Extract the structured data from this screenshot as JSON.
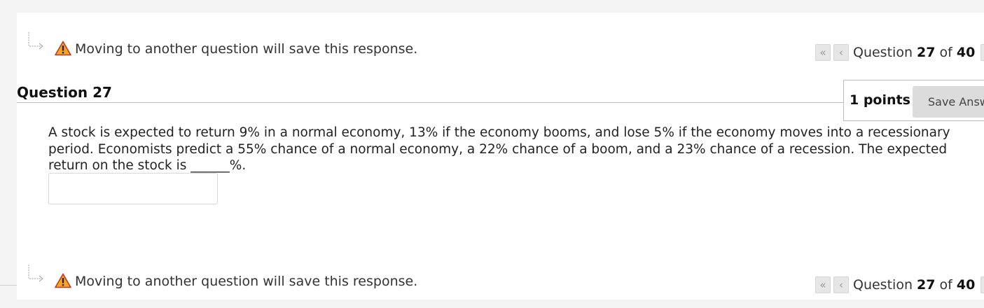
{
  "warning": {
    "text": "Moving to another question will save this response."
  },
  "nav": {
    "prefix": "Question",
    "current": "27",
    "of_word": "of",
    "total": "40",
    "first_glyph": "«",
    "prev_glyph": "‹",
    "next_glyph": "›"
  },
  "question": {
    "title": "Question 27",
    "points_label": "1 points",
    "save_label": "Save Answer",
    "body": "A stock is expected to return 9% in a normal economy, 13% if the economy booms, and lose 5% if the economy moves into a recessionary period. Economists predict a 55% chance of a normal economy, a 22% chance of a boom, and a 23% chance of a recession. The expected return on the stock is ______%.",
    "answer_value": ""
  },
  "icons": {
    "arrow": "corner-arrow-icon",
    "warning": "warning-triangle-icon"
  },
  "colors": {
    "warning_fill": "#f5a623",
    "warning_stroke": "#c0392b",
    "button_bg": "#dcdcdc"
  }
}
